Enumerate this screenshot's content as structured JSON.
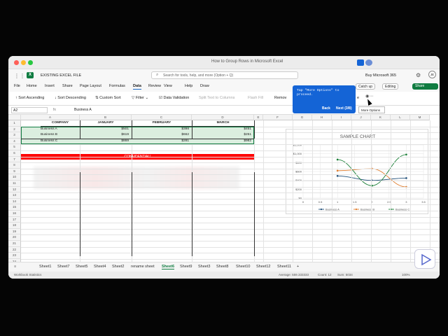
{
  "window": {
    "title": "How to Group Rows in Microsoft Excel"
  },
  "app": {
    "file_name": "EXISTING EXCEL FILE",
    "search_placeholder": "Search for tools, help, and more (Option + Q)",
    "buy": "Buy Microsoft 365",
    "avatar": "JE"
  },
  "menu": [
    "File",
    "Home",
    "Insert",
    "Share",
    "Page Layout",
    "Formulas",
    "Data",
    "Review",
    "View",
    "Help",
    "Draw"
  ],
  "menu_active": "Data",
  "ribbon_right": {
    "catch_up": "Catch up",
    "editing": "Editing",
    "share": "Share"
  },
  "toolbar": {
    "sort_asc": "Sort Ascending",
    "sort_desc": "Sort Descending",
    "custom_sort": "Custom Sort",
    "filter": "Filter",
    "data_validation": "Data Validation",
    "split_text": "Split Text to Columns",
    "flash_fill": "Flash Fill",
    "remove": "Remov",
    "more_tail": "e",
    "more_tooltip": "More Options"
  },
  "tip": {
    "text": "Tap \"More Options\" to proceed.",
    "back": "Back",
    "next": "Next (3/8)"
  },
  "formula_bar": {
    "cell_ref": "A2",
    "fx": "fx",
    "value": "Business A"
  },
  "columns": [
    "A",
    "B",
    "C",
    "D",
    "E",
    "F",
    "G",
    "H",
    "I",
    "J",
    "K",
    "L",
    "M"
  ],
  "rows": [
    "1",
    "2",
    "3",
    "4",
    "5",
    "6",
    "7",
    "8",
    "9",
    "10",
    "11",
    "12",
    "13",
    "14",
    "15",
    "16",
    "17",
    "18",
    "19",
    "20",
    "21",
    "22",
    "23",
    "24"
  ],
  "table": {
    "headers": [
      "COMPANY",
      "JANUARY",
      "FEBRUARY",
      "MARCH"
    ],
    "rows": [
      [
        "Business A",
        "$501",
        "$398",
        "$451"
      ],
      [
        "Business B",
        "$619",
        "$662",
        "$251"
      ],
      [
        "Business C",
        "$869",
        "$281",
        "$982"
      ]
    ]
  },
  "confidential": "CONFIDENTIAL!",
  "chart_data": {
    "type": "scatter",
    "title": "SAMPLE CHART",
    "xlim": [
      0,
      3.5
    ],
    "ylim": [
      0,
      1200
    ],
    "x_ticks": [
      "0",
      "0.5",
      "1",
      "1.5",
      "2",
      "2.5",
      "3",
      "3.5"
    ],
    "y_ticks": [
      "$0",
      "$200",
      "$400",
      "$600",
      "$800",
      "$1,000",
      "$1,200"
    ],
    "x": [
      1,
      2,
      3
    ],
    "series": [
      {
        "name": "Business A",
        "values": [
          501,
          398,
          451
        ],
        "color": "#1f4e79"
      },
      {
        "name": "Business B",
        "values": [
          619,
          662,
          251
        ],
        "color": "#e07b2a"
      },
      {
        "name": "Business C",
        "values": [
          869,
          281,
          982
        ],
        "color": "#1a7f37"
      }
    ],
    "legend": "bottom",
    "grid": true
  },
  "sheets": [
    "Sheet1",
    "Sheet7",
    "Sheet5",
    "Sheet4",
    "Sheet2",
    "rename sheet",
    "Sheet6",
    "Sheet9",
    "Sheet3",
    "Sheet8",
    "Sheet10",
    "Sheet12",
    "Sheet11"
  ],
  "active_sheet": "Sheet6",
  "status": {
    "left": "Workbook Statistics",
    "average": "Average: 559.333333",
    "count": "Count: 12",
    "sum": "Sum: 5034",
    "zoom": "100%"
  }
}
